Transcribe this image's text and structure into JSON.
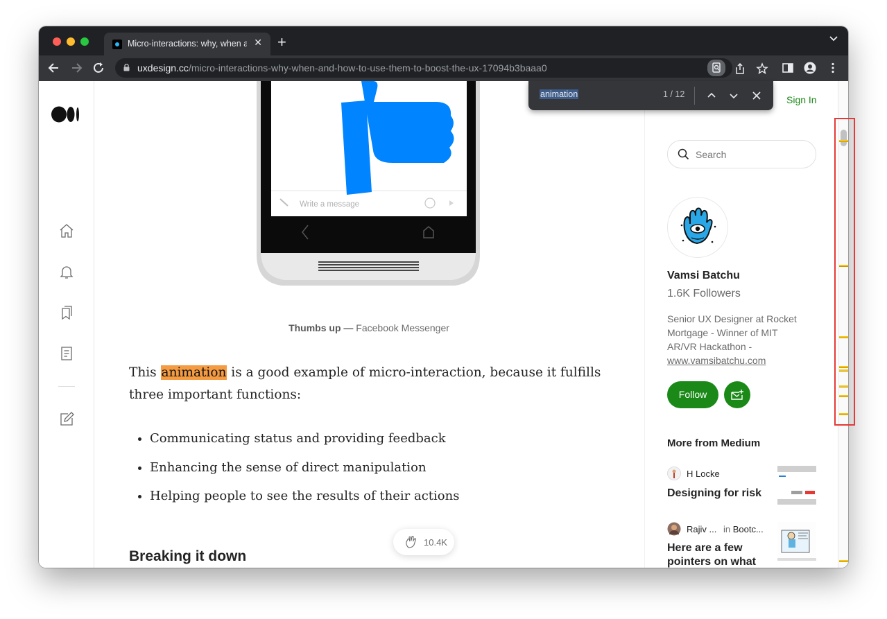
{
  "browser": {
    "tab_title": "Micro-interactions: why, when and how to use them to boost the UX",
    "tab_close": "✕",
    "new_tab": "+",
    "url_domain": "uxdesign.cc",
    "url_path": "/micro-interactions-why-when-and-how-to-use-them-to-boost-the-ux-17094b3baaa0"
  },
  "find_bar": {
    "query": "animation",
    "count": "1 / 12"
  },
  "article": {
    "image_input_placeholder": "Write a message",
    "caption_bold": "Thumbs up —",
    "caption_rest": " Facebook Messenger",
    "para_before": "This ",
    "para_highlight": "animation",
    "para_after": " is a good example of micro-interaction, because it fulfills three important functions:",
    "bullets": [
      "Communicating status and providing feedback",
      "Enhancing the sense of direct manipulation",
      "Helping people to see the results of their actions"
    ],
    "heading": "Breaking it down",
    "clap_count": "10.4K"
  },
  "sidebar": {
    "sign_in": "Sign In",
    "search_placeholder": "Search",
    "author_name": "Vamsi Batchu",
    "followers": "1.6K Followers",
    "bio": "Senior UX Designer at Rocket Mortgage - Winner of MIT AR/VR Hackathon - ",
    "bio_link": "www.vamsibatchu.com",
    "follow_label": "Follow",
    "more_from": "More from Medium",
    "recs": [
      {
        "author": "H Locke",
        "in_label": "",
        "publication": "",
        "title": "Designing for risk"
      },
      {
        "author": "Rajiv ...",
        "in_label": "in",
        "publication": "Bootc...",
        "title": "Here are a few pointers on what"
      }
    ]
  },
  "colors": {
    "medium_green": "#1a8917",
    "highlight": "#f59b42",
    "find_marker": "#f5c518",
    "annotation_red": "#e53935"
  },
  "scrollbar_marks_count": 8
}
